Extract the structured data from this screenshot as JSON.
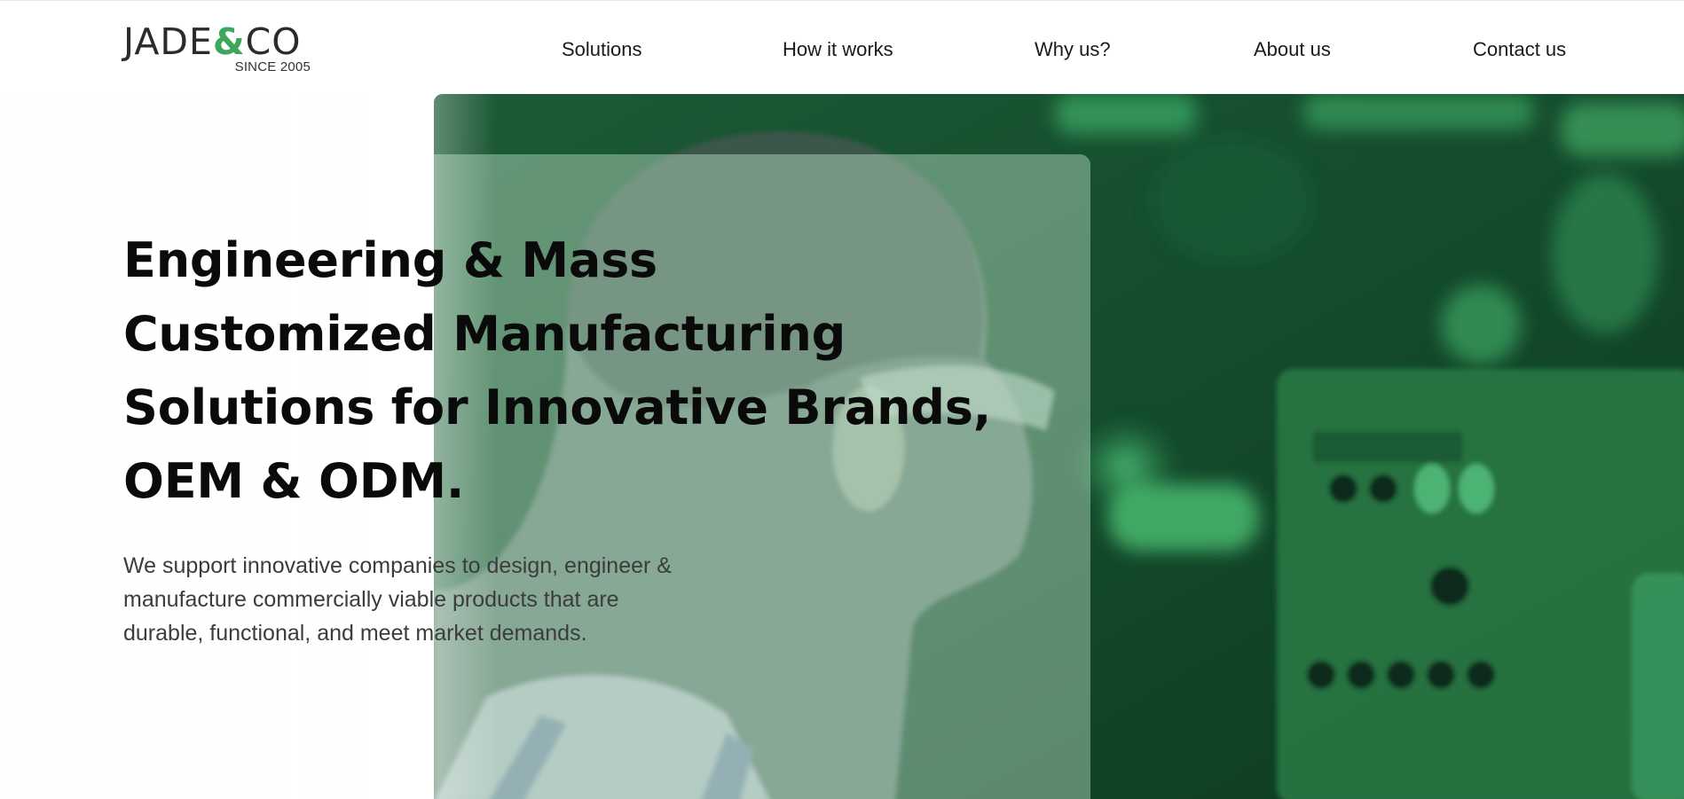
{
  "brand": {
    "name_left": "JADE",
    "name_amp": "&",
    "name_right": "CO",
    "tagline": "SINCE 2005",
    "accent_color": "#3da85a"
  },
  "nav": {
    "items": [
      {
        "label": "Solutions"
      },
      {
        "label": "How it works"
      },
      {
        "label": "Why us?"
      },
      {
        "label": "About us"
      },
      {
        "label": "Contact us"
      }
    ]
  },
  "hero": {
    "title_lines": [
      "Engineering & Mass",
      "Customized Manufacturing",
      "Solutions for Innovative Brands,",
      "OEM & ODM."
    ],
    "subtitle_lines": [
      "We support innovative companies to design, engineer &",
      "manufacture commercially viable products that are",
      "durable, functional, and meet market demands."
    ],
    "image_subject": "engineer-with-safety-glasses-photo",
    "overlay_color": "#1f8a47"
  }
}
